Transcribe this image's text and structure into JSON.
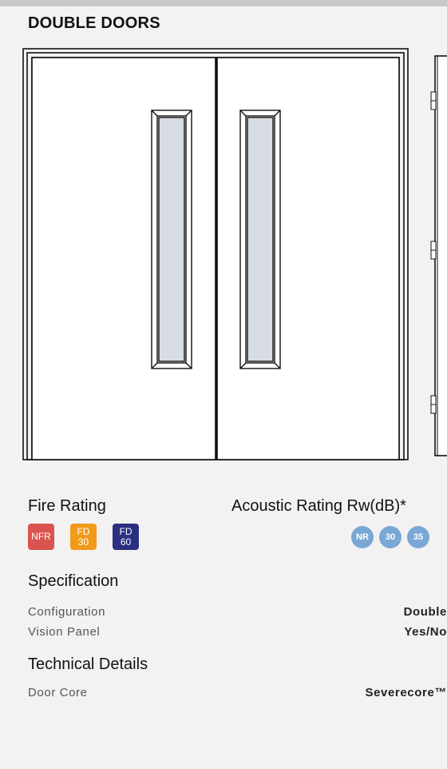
{
  "page": {
    "title": "DOUBLE DOORS"
  },
  "ratings": {
    "fire_label": "Fire Rating",
    "fire_badges": [
      {
        "label": "NFR",
        "color": "#d9534f"
      },
      {
        "label": "FD\n30",
        "color": "#f29a1a"
      },
      {
        "label": "FD\n60",
        "color": "#2b2f80"
      }
    ],
    "acoustic_label": "Acoustic Rating Rw(dB)*",
    "acoustic_badges": [
      {
        "label": "NR"
      },
      {
        "label": "30"
      },
      {
        "label": "35"
      }
    ]
  },
  "specification": {
    "heading": "Specification",
    "rows": [
      {
        "label": "Configuration",
        "value": "Double"
      },
      {
        "label": "Vision Panel",
        "value": "Yes/No"
      }
    ]
  },
  "technical": {
    "heading": "Technical Details",
    "rows": [
      {
        "label": "Door Core",
        "value": "Severecore™"
      }
    ]
  },
  "colors": {
    "background": "#f2f2f2",
    "door_fill": "#ffffff",
    "glass": "#d7dde3",
    "acoustic_dot": "#7aa8d4"
  }
}
